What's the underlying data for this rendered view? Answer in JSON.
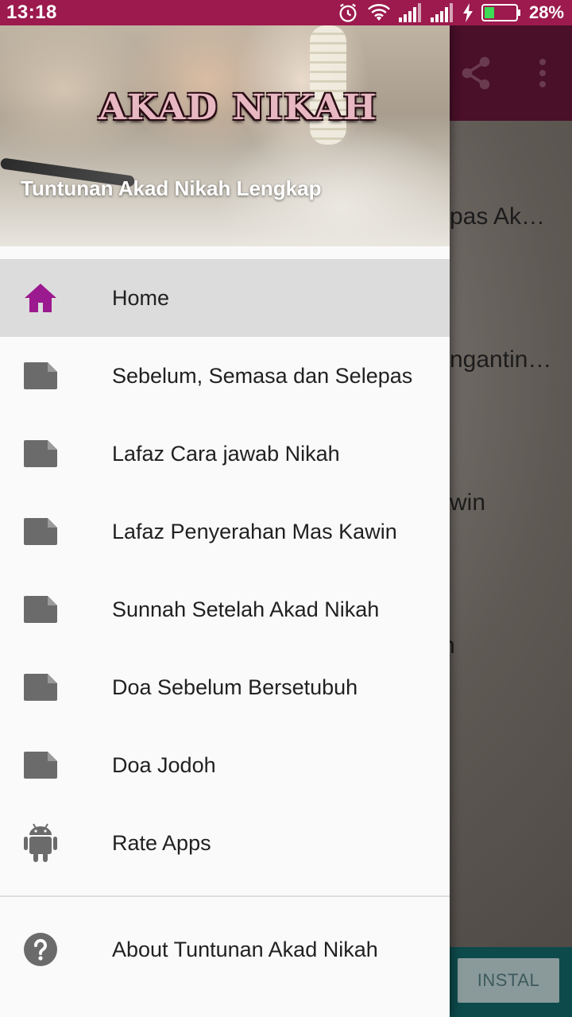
{
  "status_bar": {
    "time": "13:18",
    "battery_percent": "28%",
    "icons": [
      "alarm-icon",
      "wifi-icon",
      "signal-icon",
      "signal-icon",
      "charging-icon",
      "battery-icon"
    ]
  },
  "background_app": {
    "toolbar_icons": [
      "share-icon",
      "more-vert-icon"
    ],
    "partial_items": [
      "pas Ak…",
      "ngantin…",
      "win",
      "n"
    ],
    "ad_button": "INSTAL"
  },
  "drawer": {
    "header": {
      "title": "AKAD NIKAH",
      "subtitle": "Tuntunan Akad Nikah Lengkap"
    },
    "items": [
      {
        "label": "Home",
        "icon": "home-icon",
        "active": true
      },
      {
        "label": "Sebelum, Semasa dan Selepas",
        "icon": "document-icon"
      },
      {
        "label": "Lafaz Cara jawab Nikah",
        "icon": "document-icon"
      },
      {
        "label": "Lafaz Penyerahan Mas Kawin",
        "icon": "document-icon"
      },
      {
        "label": "Sunnah Setelah Akad Nikah",
        "icon": "document-icon"
      },
      {
        "label": "Doa Sebelum Bersetubuh",
        "icon": "document-icon"
      },
      {
        "label": "Doa Jodoh",
        "icon": "document-icon"
      },
      {
        "label": "Rate Apps",
        "icon": "android-icon"
      }
    ],
    "about": {
      "label": "About Tuntunan Akad Nikah",
      "icon": "help-icon"
    }
  },
  "colors": {
    "status_bar": "#9c1a4d",
    "accent": "#9c1a8f",
    "icon_gray": "#6b6b6b",
    "active_bg": "#dcdcdc"
  }
}
